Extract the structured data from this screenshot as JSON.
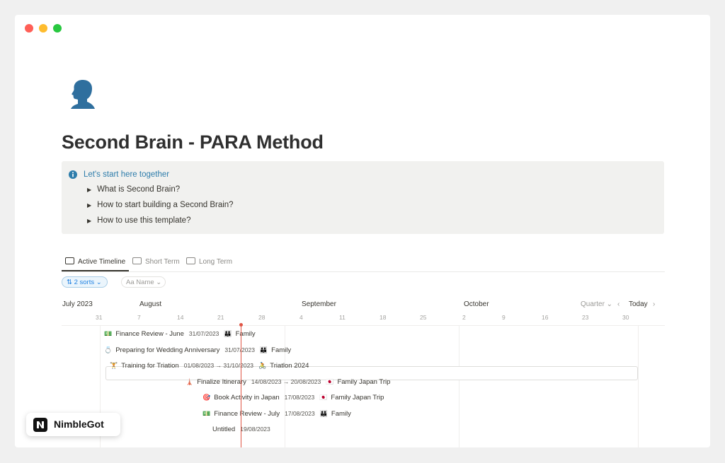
{
  "page": {
    "icon": "person-head-icon",
    "title": "Second Brain - PARA Method"
  },
  "callout": {
    "icon": "info-icon",
    "heading": "Let's start here together",
    "toggles": [
      "What is Second Brain?",
      "How to start building a Second Brain?",
      "How to use this template?"
    ]
  },
  "tabs": [
    {
      "label": "Active Timeline",
      "active": true
    },
    {
      "label": "Short Term",
      "active": false
    },
    {
      "label": "Long Term",
      "active": false
    }
  ],
  "filters": {
    "sort_label": "⇅ 2 sorts ⌄",
    "name_label": "Aa Name ⌄"
  },
  "timeline": {
    "months": [
      "July 2023",
      "August",
      "September",
      "October"
    ],
    "days": [
      "31",
      "7",
      "14",
      "21",
      "28",
      "4",
      "11",
      "18",
      "25",
      "2",
      "9",
      "16",
      "23",
      "30"
    ],
    "zoom": "Quarter ⌄",
    "today": "Today",
    "today_date": "2023-08-21",
    "rows": [
      {
        "emoji": "💵",
        "name": "Finance Review - June",
        "date": "31/07/2023",
        "tag_emoji": "👪",
        "tag": "Family"
      },
      {
        "emoji": "💍",
        "name": "Preparing for Wedding Anniversary",
        "date": "31/07/2023",
        "tag_emoji": "👪",
        "tag": "Family"
      },
      {
        "emoji": "🏋",
        "name": "Training for Triation",
        "date": "01/08/2023 → 31/10/2023",
        "tag_emoji": "🚴",
        "tag": "Triatlon 2024"
      },
      {
        "emoji": "🗼",
        "name": "Finalize Itinerary",
        "date": "14/08/2023 → 20/08/2023",
        "tag_emoji": "🇯🇵",
        "tag": "Family Japan Trip"
      },
      {
        "emoji": "🎯",
        "name": "Book Activity in Japan",
        "date": "17/08/2023",
        "tag_emoji": "🇯🇵",
        "tag": "Family Japan Trip"
      },
      {
        "emoji": "💵",
        "name": "Finance Review - July",
        "date": "17/08/2023",
        "tag_emoji": "👪",
        "tag": "Family"
      },
      {
        "emoji": "",
        "name": "Untitled",
        "date": "19/08/2023",
        "tag_emoji": "",
        "tag": ""
      }
    ]
  },
  "brand": {
    "name": "NimbleGot"
  },
  "colors": {
    "accent": "#2383e2",
    "callout_heading": "#2e7dab",
    "today_line": "#e05545",
    "callout_bg": "#f1f1ef"
  }
}
